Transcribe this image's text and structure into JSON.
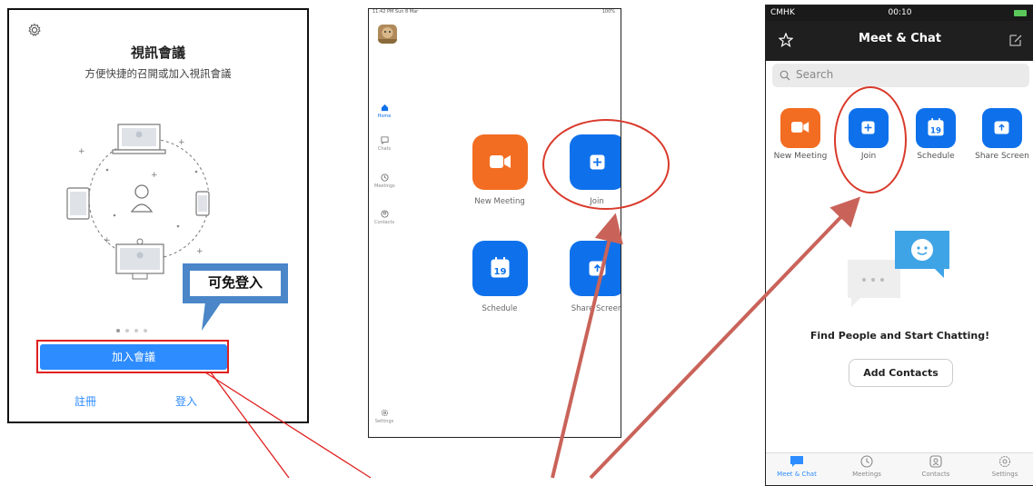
{
  "panel_welcome": {
    "title": "視訊會議",
    "subtitle": "方便快捷的召開或加入視訊會議",
    "join_button": "加入會議",
    "signup_link": "註冊",
    "login_link": "登入",
    "callout": "可免登入",
    "icons": [
      "gear-icon",
      "devices-illustration"
    ]
  },
  "panel_ipad": {
    "status_left": "11:42 PM  Sun 8 Mar",
    "status_right": "100%",
    "sidebar": [
      {
        "label": "Home",
        "icon": "home-icon"
      },
      {
        "label": "Chats",
        "icon": "chat-icon"
      },
      {
        "label": "Meetings",
        "icon": "clock-icon"
      },
      {
        "label": "Contacts",
        "icon": "contact-icon"
      }
    ],
    "settings_label": "Settings",
    "tiles": [
      {
        "label": "New Meeting",
        "icon": "video-camera-icon",
        "color": "#f26d21"
      },
      {
        "label": "Join",
        "icon": "plus-icon",
        "color": "#0e71eb"
      },
      {
        "label": "Schedule",
        "icon": "calendar-icon",
        "calendar_day": "19",
        "color": "#0e71eb"
      },
      {
        "label": "Share Screen",
        "icon": "share-screen-icon",
        "color": "#0e71eb"
      }
    ]
  },
  "panel_phone": {
    "carrier": "CMHK",
    "time": "00:10",
    "title": "Meet & Chat",
    "search_placeholder": "Search",
    "tiles": [
      {
        "label": "New Meeting",
        "icon": "video-camera-icon",
        "color": "#f26d21"
      },
      {
        "label": "Join",
        "icon": "plus-icon",
        "color": "#0e71eb"
      },
      {
        "label": "Schedule",
        "icon": "calendar-icon",
        "calendar_day": "19",
        "color": "#0e71eb"
      },
      {
        "label": "Share Screen",
        "icon": "share-screen-icon",
        "color": "#0e71eb"
      }
    ],
    "empty_title": "Find People and Start Chatting!",
    "add_contacts": "Add Contacts",
    "tabs": [
      {
        "label": "Meet & Chat",
        "icon": "chat-bubble-icon",
        "active": true
      },
      {
        "label": "Meetings",
        "icon": "clock-icon",
        "active": false
      },
      {
        "label": "Contacts",
        "icon": "contact-icon",
        "active": false
      },
      {
        "label": "Settings",
        "icon": "gear-icon",
        "active": false
      }
    ]
  },
  "colors": {
    "accent": "#2d8cff",
    "highlight": "#d93a2b",
    "arrow": "#c9635a",
    "callout_border": "#4a86c8"
  }
}
